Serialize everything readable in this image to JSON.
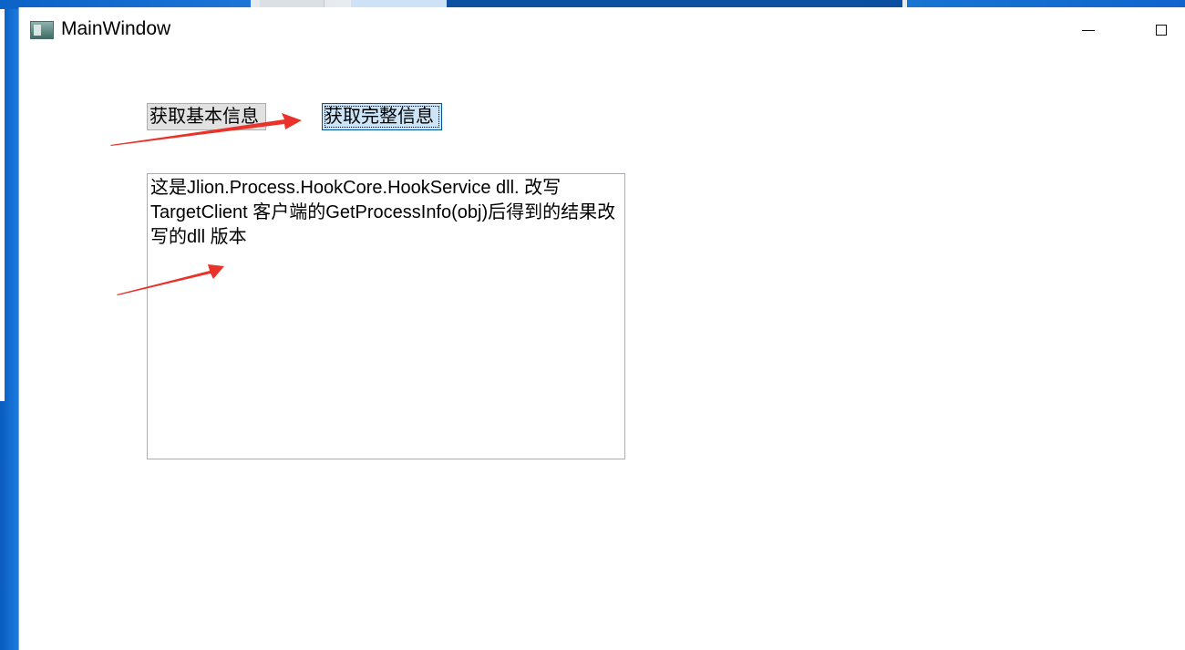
{
  "window": {
    "title": "MainWindow"
  },
  "buttons": {
    "basic_info_label": "获取基本信息",
    "full_info_label": "获取完整信息"
  },
  "output": {
    "text": "这是Jlion.Process.HookCore.HookService dll. 改写TargetClient 客户端的GetProcessInfo(obj)后得到的结果改写的dll 版本"
  },
  "icons": {
    "app": "window-app-icon",
    "minimize": "minimize-icon",
    "maximize": "maximize-icon"
  },
  "colors": {
    "annotation_arrow": "#e8322a",
    "focused_button_bg": "#cce4f7",
    "button_bg": "#e1e1e1",
    "desktop_bg": "#1e7fd8"
  }
}
